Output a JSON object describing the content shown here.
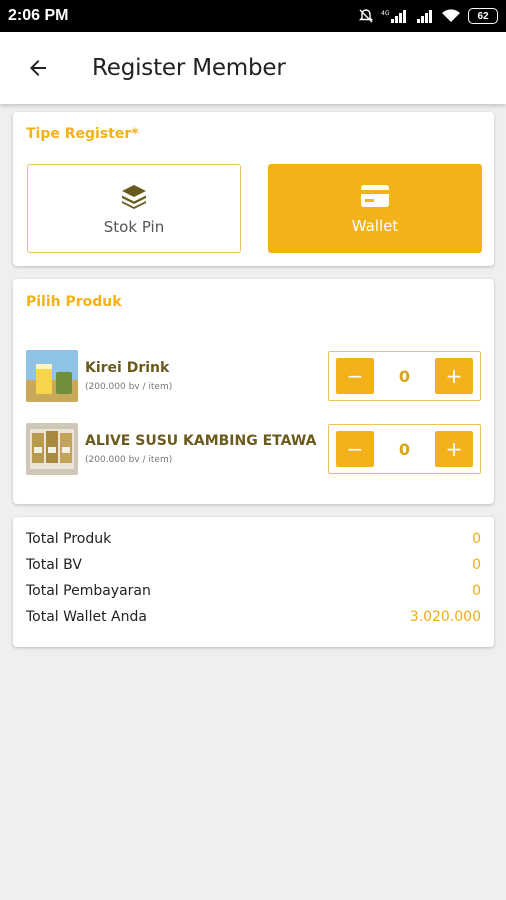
{
  "status": {
    "time": "2:06 PM",
    "battery": "62"
  },
  "appbar": {
    "title": "Register Member"
  },
  "register_type": {
    "title": "Tipe Register*",
    "options": [
      {
        "label": "Stok Pin",
        "icon": "layers-icon",
        "selected": false
      },
      {
        "label": "Wallet",
        "icon": "wallet-card-icon",
        "selected": true
      }
    ]
  },
  "products": {
    "title": "Pilih Produk",
    "items": [
      {
        "name": "Kirei Drink",
        "price": "(200.000 bv / item)",
        "qty": "0",
        "minus": "−",
        "plus": "+"
      },
      {
        "name": "ALIVE SUSU KAMBING ETAWA",
        "price": "(200.000 bv / item)",
        "qty": "0",
        "minus": "−",
        "plus": "+"
      }
    ]
  },
  "totals": [
    {
      "label": "Total Produk",
      "value": "0"
    },
    {
      "label": "Total BV",
      "value": "0"
    },
    {
      "label": "Total Pembayaran",
      "value": "0"
    },
    {
      "label": "Total Wallet Anda",
      "value": "3.020.000"
    }
  ],
  "colors": {
    "accent": "#f4b21a",
    "product_name": "#6b5a1e",
    "background": "#efefef"
  }
}
